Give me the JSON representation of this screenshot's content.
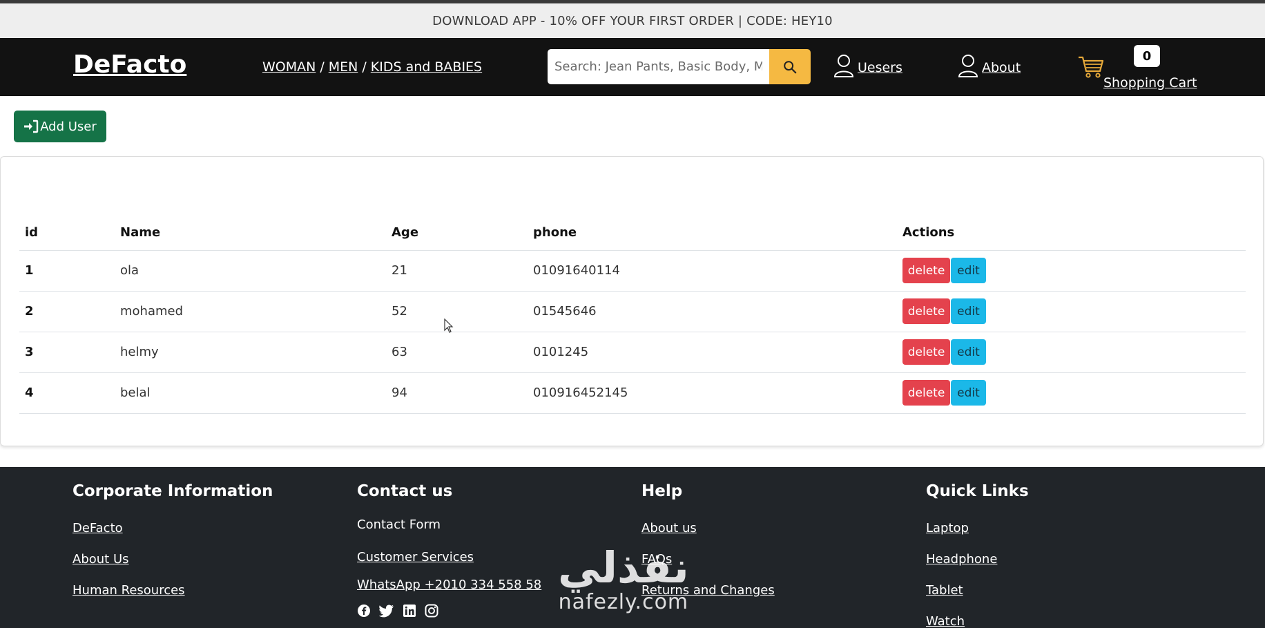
{
  "promo": {
    "text": "DOWNLOAD APP - 10% OFF YOUR FIRST ORDER | CODE: HEY10"
  },
  "navbar": {
    "brand": "DeFacto",
    "categories": [
      "WOMAN",
      "MEN",
      "KIDS and BABIES"
    ],
    "separator": "/",
    "search_placeholder": "Search: Jean Pants, Basic Body, Mom Jeans",
    "users_label": "Uesers",
    "about_label": "About",
    "cart_count": "0",
    "cart_label": "Shopping Cart"
  },
  "actions": {
    "add_user_label": "Add User"
  },
  "table": {
    "headers": [
      "id",
      "Name",
      "Age",
      "phone",
      "Actions"
    ],
    "rows": [
      {
        "id": "1",
        "name": "ola",
        "age": "21",
        "phone": "01091640114"
      },
      {
        "id": "2",
        "name": "mohamed",
        "age": "52",
        "phone": "01545646"
      },
      {
        "id": "3",
        "name": "helmy",
        "age": "63",
        "phone": "0101245"
      },
      {
        "id": "4",
        "name": "belal",
        "age": "94",
        "phone": "010916452145"
      }
    ],
    "delete_label": "delete",
    "edit_label": "edit"
  },
  "footer": {
    "corporate": {
      "title": "Corporate Information",
      "links": [
        "DeFacto",
        "About Us",
        "Human Resources"
      ]
    },
    "contact": {
      "title": "Contact us",
      "plain": "Contact Form",
      "links": [
        "Customer Services",
        "WhatsApp +2010 334 558 58"
      ]
    },
    "help": {
      "title": "Help",
      "links": [
        "About us",
        "FAQs",
        "Returns and Changes"
      ]
    },
    "quick": {
      "title": "Quick Links",
      "links": [
        "Laptop",
        "Headphone",
        "Tablet",
        "Watch"
      ]
    },
    "social_icons": [
      "facebook-icon",
      "twitter-icon",
      "linkedin-icon",
      "instagram-icon"
    ]
  },
  "watermark": {
    "arabic": "نفذلي",
    "latin": "nafezly.com"
  },
  "colors": {
    "search_button": "#f5b942",
    "add_user": "#157347",
    "delete": "#e4424d",
    "edit": "#1bb8e8",
    "footer": "#212529",
    "navbar": "#121212"
  }
}
